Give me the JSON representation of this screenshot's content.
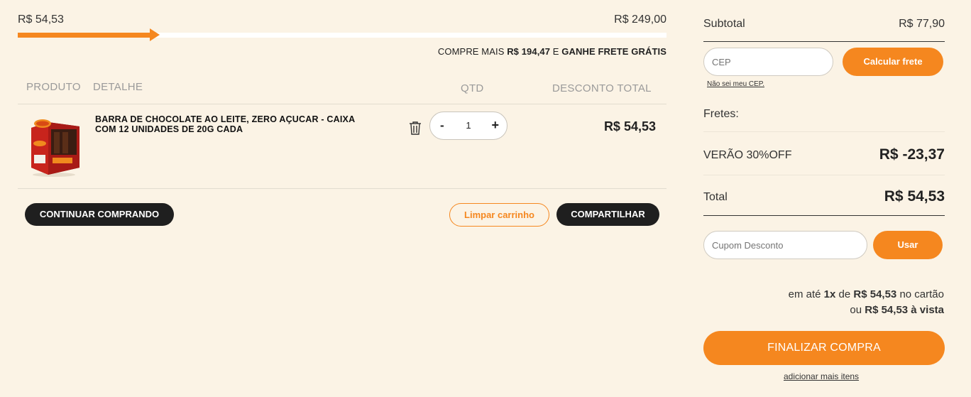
{
  "progress": {
    "current": "R$ 54,53",
    "goal": "R$ 249,00",
    "fraction": 0.219,
    "message_prefix": "COMPRE MAIS ",
    "message_amount": "R$ 194,47",
    "message_mid": " E ",
    "message_suffix": "GANHE FRETE GRÁTIS"
  },
  "table": {
    "headers": {
      "product": "PRODUTO",
      "detail": "DETALHE",
      "qty": "QTD",
      "discount": "DESCONTO TOTAL"
    },
    "items": [
      {
        "name": "BARRA DE CHOCOLATE AO LEITE, ZERO AÇUCAR - CAIXA COM 12 UNIDADES DE 20G CADA",
        "qty": "1",
        "price": "R$ 54,53",
        "image_icon": "chocolate-box-product-image"
      }
    ],
    "qty_minus": "-",
    "qty_plus": "+"
  },
  "actions": {
    "continue": "CONTINUAR COMPRANDO",
    "clear": "Limpar carrinho",
    "share": "COMPARTILHAR"
  },
  "summary": {
    "subtotal_label": "Subtotal",
    "subtotal_value": "R$ 77,90",
    "cep_placeholder": "CEP",
    "calc_freight": "Calcular frete",
    "unknown_cep": "Não sei meu CEP.",
    "freights_label": "Fretes:",
    "discount_label": "VERÃO 30%OFF",
    "discount_value": "R$ -23,37",
    "total_label": "Total",
    "total_value": "R$ 54,53",
    "coupon_placeholder": "Cupom Desconto",
    "use_coupon": "Usar",
    "installment_prefix": "em até ",
    "installment_count": "1x",
    "installment_mid": " de ",
    "installment_amount": "R$ 54,53",
    "installment_suffix": " no cartão",
    "cash_prefix": "ou ",
    "cash_amount": "R$ 54,53 à vista",
    "finish": "FINALIZAR COMPRA",
    "add_more": "adicionar mais itens"
  },
  "colors": {
    "accent": "#f5871f",
    "background": "#fbf3e5",
    "dark_button": "#1f1f1f"
  }
}
